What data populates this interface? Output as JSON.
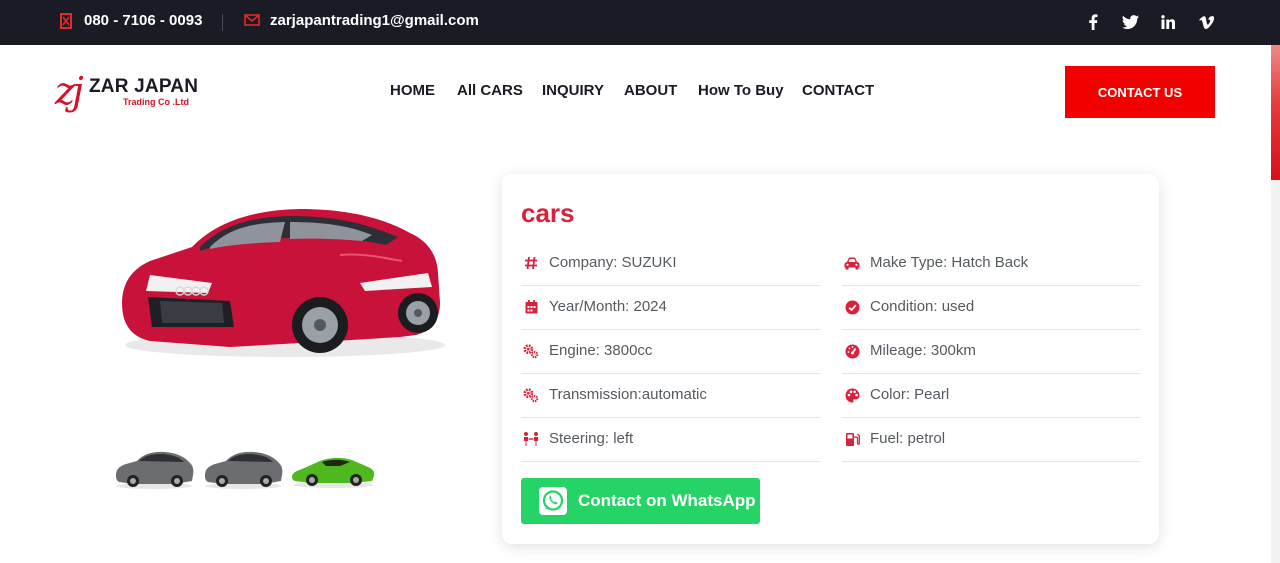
{
  "topbar": {
    "phone": "080 - 7106 - 0093",
    "email": "zarjapantrading1@gmail.com",
    "social": [
      "facebook-icon",
      "twitter-icon",
      "linkedin-icon",
      "vimeo-icon"
    ]
  },
  "logo": {
    "mark": "zj",
    "name": "ZAR JAPAN",
    "sub": "Trading Co .Ltd"
  },
  "nav": [
    "HOME",
    "All CARS",
    "INQUIRY",
    "ABOUT",
    "How To Buy",
    "CONTACT"
  ],
  "cta": "CONTACT US",
  "gallery": {
    "main_color": "#c8123a",
    "thumbs": [
      {
        "icon": "car-thumbnail-gray",
        "color": "#6b6d70"
      },
      {
        "icon": "car-thumbnail-gray",
        "color": "#6b6d70"
      },
      {
        "icon": "car-thumbnail-green",
        "color": "#4fb81f"
      }
    ]
  },
  "details": {
    "title": "cars",
    "left": [
      {
        "icon": "hash-icon",
        "text": "Company: SUZUKI"
      },
      {
        "icon": "calendar-icon",
        "text": "Year/Month: 2024"
      },
      {
        "icon": "cogs-icon",
        "text": "Engine: 3800cc"
      },
      {
        "icon": "cogs-icon",
        "text": "Transmission:automatic"
      },
      {
        "icon": "steering-icon",
        "text": "Steering: left"
      }
    ],
    "right": [
      {
        "icon": "car-icon",
        "text": "Make Type: Hatch Back"
      },
      {
        "icon": "check-circle-icon",
        "text": "Condition: used"
      },
      {
        "icon": "gauge-icon",
        "text": "Mileage: 300km"
      },
      {
        "icon": "palette-icon",
        "text": "Color: Pearl"
      },
      {
        "icon": "fuel-icon",
        "text": "Fuel: petrol"
      }
    ],
    "whatsapp": "Contact on WhatsApp"
  },
  "colors": {
    "accent": "#d8223a",
    "cta": "#f20000",
    "whatsapp": "#25d366",
    "topbar": "#1a1b24"
  }
}
